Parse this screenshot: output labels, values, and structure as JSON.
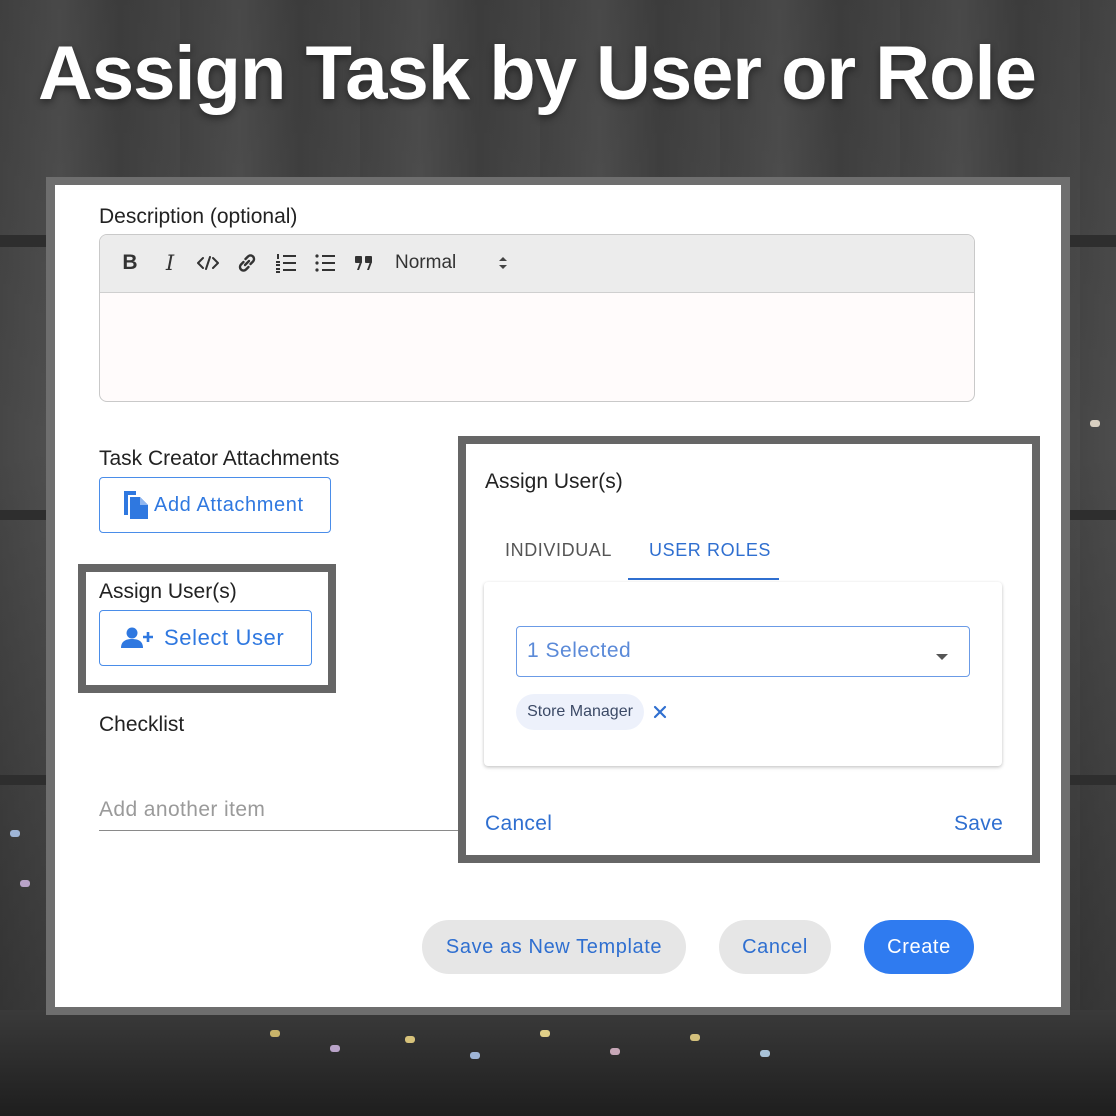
{
  "headline": "Assign Task by User or Role",
  "form": {
    "description_label": "Description (optional)",
    "toolbar": {
      "bold": "B",
      "italic": "I",
      "format_value": "Normal"
    },
    "attachments_label": "Task Creator Attachments",
    "add_attachment_label": "Add Attachment",
    "assign_label": "Assign User(s)",
    "select_user_label": "Select User",
    "checklist_label": "Checklist",
    "checklist_placeholder": "Add another item",
    "actions": {
      "save_template": "Save as New Template",
      "cancel": "Cancel",
      "create": "Create"
    }
  },
  "dialog": {
    "title": "Assign User(s)",
    "tabs": [
      "INDIVIDUAL",
      "USER ROLES"
    ],
    "active_tab": "USER ROLES",
    "select_value": "1 Selected",
    "chips": [
      "Store Manager"
    ],
    "cancel": "Cancel",
    "save": "Save"
  },
  "colors": {
    "accent": "#2f78e0",
    "create_bg": "#2f7bf0",
    "pill_bg": "#e6e6e6",
    "highlight_frame": "#666666"
  }
}
